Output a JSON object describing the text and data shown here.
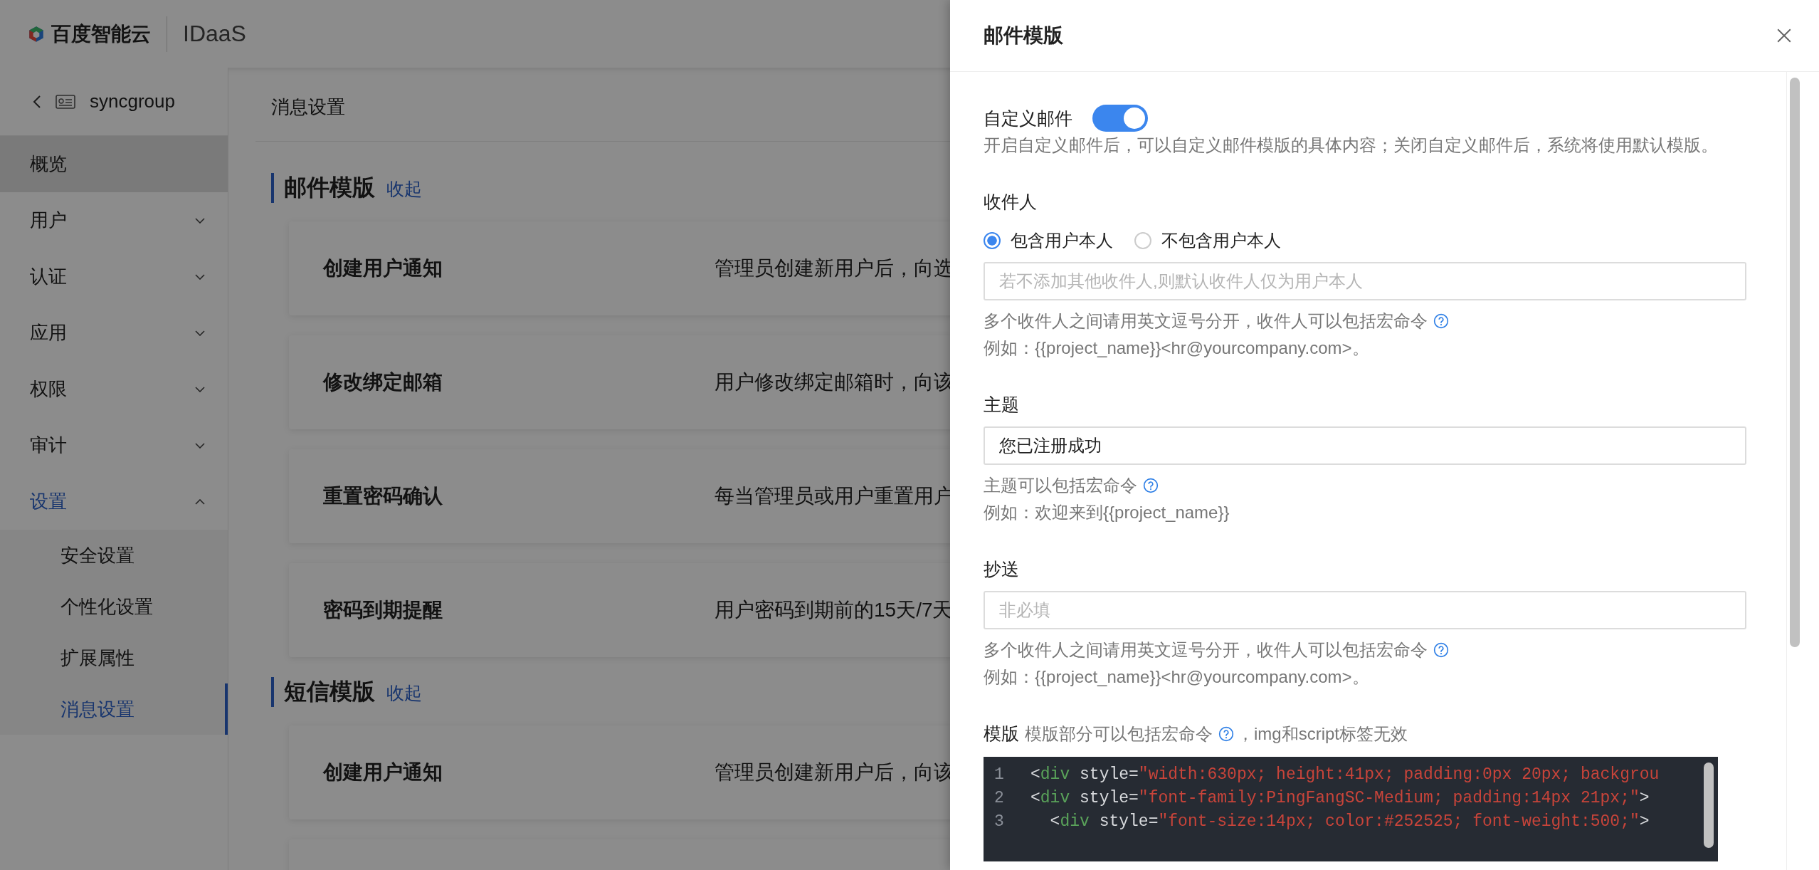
{
  "header": {
    "logo_text": "百度智能云",
    "product": "IDaaS"
  },
  "sidebar": {
    "back_label": "syncgroup",
    "items": [
      {
        "label": "概览",
        "kind": "link",
        "highlighted": true,
        "selected": false
      },
      {
        "label": "用户",
        "kind": "group",
        "expanded": false,
        "highlighted": false,
        "selected": false
      },
      {
        "label": "认证",
        "kind": "group",
        "expanded": false,
        "highlighted": false,
        "selected": false
      },
      {
        "label": "应用",
        "kind": "group",
        "expanded": false,
        "highlighted": false,
        "selected": false
      },
      {
        "label": "权限",
        "kind": "group",
        "expanded": false,
        "highlighted": false,
        "selected": false
      },
      {
        "label": "审计",
        "kind": "group",
        "expanded": false,
        "highlighted": false,
        "selected": false
      },
      {
        "label": "设置",
        "kind": "group",
        "expanded": true,
        "highlighted": false,
        "selected": true,
        "children": [
          {
            "label": "安全设置",
            "selected": false
          },
          {
            "label": "个性化设置",
            "selected": false
          },
          {
            "label": "扩展属性",
            "selected": false
          },
          {
            "label": "消息设置",
            "selected": true
          }
        ]
      }
    ]
  },
  "main": {
    "breadcrumb": "消息设置",
    "sections": [
      {
        "title": "邮件模版",
        "toggle": "收起",
        "rows": [
          {
            "name": "创建用户通知",
            "description": "管理员创建新用户后，向选"
          },
          {
            "name": "修改绑定邮箱",
            "description": "用户修改绑定邮箱时，向该"
          },
          {
            "name": "重置密码确认",
            "description": "每当管理员或用户重置用户"
          },
          {
            "name": "密码到期提醒",
            "description": "用户密码到期前的15天/7天"
          }
        ]
      },
      {
        "title": "短信模版",
        "toggle": "收起",
        "rows": [
          {
            "name": "创建用户通知",
            "description": "管理员创建新用户后，向该"
          },
          {
            "name": "",
            "description": ""
          }
        ]
      }
    ]
  },
  "drawer": {
    "title": "邮件模版",
    "custom": {
      "label": "自定义邮件",
      "on": true,
      "hint": "开启自定义邮件后，可以自定义邮件模版的具体内容；关闭自定义邮件后，系统将使用默认模版。"
    },
    "recipients": {
      "label": "收件人",
      "options": [
        {
          "label": "包含用户本人",
          "selected": true
        },
        {
          "label": "不包含用户本人",
          "selected": false
        }
      ],
      "placeholder": "若不添加其他收件人,则默认收件人仅为用户本人",
      "help": "多个收件人之间请用英文逗号分开，收件人可以包括宏命令",
      "example": "例如：{{project_name}}<hr@yourcompany.com>。"
    },
    "subject": {
      "label": "主题",
      "value": "您已注册成功",
      "help": "主题可以包括宏命令",
      "example": "例如：欢迎来到{{project_name}}"
    },
    "cc": {
      "label": "抄送",
      "placeholder": "非必填",
      "help": "多个收件人之间请用英文逗号分开，收件人可以包括宏命令",
      "example": "例如：{{project_name}}<hr@yourcompany.com>。"
    },
    "template": {
      "label": "模版",
      "hint_before": "模版部分可以包括宏命令",
      "hint_after": "，img和script标签无效",
      "lines": [
        {
          "number": "1",
          "tokens": [
            {
              "kind": "punct",
              "text": "<"
            },
            {
              "kind": "tag",
              "text": "div"
            },
            {
              "kind": "punct",
              "text": " style="
            },
            {
              "kind": "string",
              "text": "\"width:630px; height:41px; padding:0px 20px; backgrou"
            }
          ]
        },
        {
          "number": "2",
          "tokens": [
            {
              "kind": "punct",
              "text": "<"
            },
            {
              "kind": "tag",
              "text": "div"
            },
            {
              "kind": "punct",
              "text": " style="
            },
            {
              "kind": "string",
              "text": "\"font-family:PingFangSC-Medium; padding:14px 21px;\""
            },
            {
              "kind": "punct",
              "text": ">"
            }
          ]
        },
        {
          "number": "3",
          "tokens": [
            {
              "kind": "punct",
              "text": "  <"
            },
            {
              "kind": "tag",
              "text": "div"
            },
            {
              "kind": "punct",
              "text": " style="
            },
            {
              "kind": "string",
              "text": "\"font-size:14px; color:#252525; font-weight:500;\""
            },
            {
              "kind": "punct",
              "text": ">"
            }
          ]
        }
      ]
    }
  }
}
